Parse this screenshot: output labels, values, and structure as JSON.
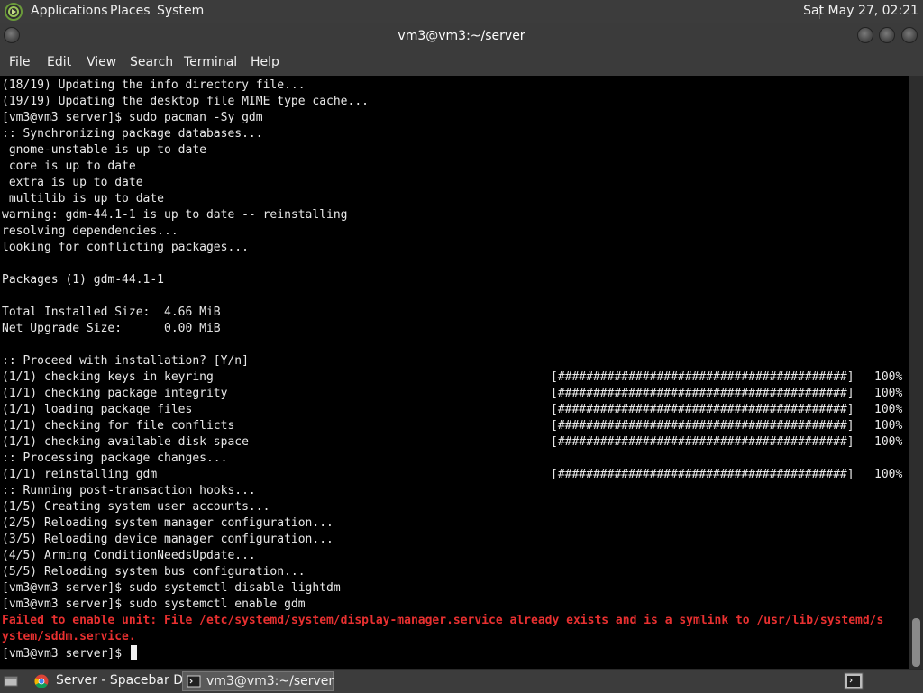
{
  "top_panel": {
    "menus": [
      "Applications",
      "Places",
      "System"
    ],
    "clock": "Sat May 27, 02:21"
  },
  "window": {
    "title": "vm3@vm3:~/server",
    "menu": [
      "File",
      "Edit",
      "View",
      "Search",
      "Terminal",
      "Help"
    ]
  },
  "terminal": {
    "lines": [
      "(18/19) Updating the info directory file...",
      "(19/19) Updating the desktop file MIME type cache...",
      "[vm3@vm3 server]$ sudo pacman -Sy gdm",
      ":: Synchronizing package databases...",
      " gnome-unstable is up to date",
      " core is up to date",
      " extra is up to date",
      " multilib is up to date",
      "warning: gdm-44.1-1 is up to date -- reinstalling",
      "resolving dependencies...",
      "looking for conflicting packages...",
      "",
      "Packages (1) gdm-44.1-1",
      "",
      "Total Installed Size:  4.66 MiB",
      "Net Upgrade Size:      0.00 MiB",
      "",
      ":: Proceed with installation? [Y/n]",
      "(1/1) checking keys in keyring",
      "(1/1) checking package integrity",
      "(1/1) loading package files",
      "(1/1) checking for file conflicts",
      "(1/1) checking available disk space",
      ":: Processing package changes...",
      "(1/1) reinstalling gdm",
      ":: Running post-transaction hooks...",
      "(1/5) Creating system user accounts...",
      "(2/5) Reloading system manager configuration...",
      "(3/5) Reloading device manager configuration...",
      "(4/5) Arming ConditionNeedsUpdate...",
      "(5/5) Reloading system bus configuration...",
      "[vm3@vm3 server]$ sudo systemctl disable lightdm",
      "[vm3@vm3 server]$ sudo systemctl enable gdm"
    ],
    "error_lines": [
      "Failed to enable unit: File /etc/systemd/system/display-manager.service already exists and is a symlink to /usr/lib/systemd/s",
      "ystem/sddm.service."
    ],
    "prompt": "[vm3@vm3 server]$ ",
    "progress_bar": "[#########################################]",
    "progress_pct": "100%",
    "progress_rows": [
      18,
      19,
      20,
      21,
      22,
      24
    ]
  },
  "taskbar": {
    "items": [
      "Server - Spacebar D...",
      "vm3@vm3:~/server"
    ]
  }
}
